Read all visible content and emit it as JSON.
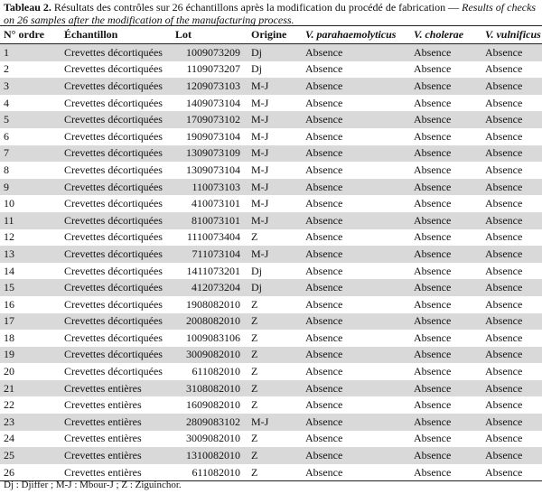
{
  "caption": {
    "label": "Tableau 2.",
    "text_fr": "Résultats des contrôles sur 26 échantillons après la modification du procédé de fabrication",
    "separator": " — ",
    "text_en": "Results of checks on 26 samples after the modification of the manufacturing process."
  },
  "table": {
    "headers": [
      "N° ordre",
      "Échantillon",
      "Lot",
      "Origine",
      "V. parahaemolyticus",
      "V. cholerae",
      "V. vulnificus"
    ],
    "rows": [
      [
        "1",
        "Crevettes décortiquées",
        "1009073209",
        "Dj",
        "Absence",
        "Absence",
        "Absence"
      ],
      [
        "2",
        "Crevettes décortiquées",
        "1109073207",
        "Dj",
        "Absence",
        "Absence",
        "Absence"
      ],
      [
        "3",
        "Crevettes décortiquées",
        "1209073103",
        "M-J",
        "Absence",
        "Absence",
        "Absence"
      ],
      [
        "4",
        "Crevettes décortiquées",
        "1409073104",
        "M-J",
        "Absence",
        "Absence",
        "Absence"
      ],
      [
        "5",
        "Crevettes décortiquées",
        "1709073102",
        "M-J",
        "Absence",
        "Absence",
        "Absence"
      ],
      [
        "6",
        "Crevettes décortiquées",
        "1909073104",
        "M-J",
        "Absence",
        "Absence",
        "Absence"
      ],
      [
        "7",
        "Crevettes décortiquées",
        "1309073109",
        "M-J",
        "Absence",
        "Absence",
        "Absence"
      ],
      [
        "8",
        "Crevettes décortiquées",
        "1309073104",
        "M-J",
        "Absence",
        "Absence",
        "Absence"
      ],
      [
        "9",
        "Crevettes décortiquées",
        "110073103",
        "M-J",
        "Absence",
        "Absence",
        "Absence"
      ],
      [
        "10",
        "Crevettes décortiquées",
        "410073101",
        "M-J",
        "Absence",
        "Absence",
        "Absence"
      ],
      [
        "11",
        "Crevettes décortiquées",
        "810073101",
        "M-J",
        "Absence",
        "Absence",
        "Absence"
      ],
      [
        "12",
        "Crevettes décortiquées",
        "1110073404",
        "Z",
        "Absence",
        "Absence",
        "Absence"
      ],
      [
        "13",
        "Crevettes décortiquées",
        "711073104",
        "M-J",
        "Absence",
        "Absence",
        "Absence"
      ],
      [
        "14",
        "Crevettes décortiquées",
        "1411073201",
        "Dj",
        "Absence",
        "Absence",
        "Absence"
      ],
      [
        "15",
        "Crevettes décortiquées",
        "412073204",
        "Dj",
        "Absence",
        "Absence",
        "Absence"
      ],
      [
        "16",
        "Crevettes décortiquées",
        "1908082010",
        "Z",
        "Absence",
        "Absence",
        "Absence"
      ],
      [
        "17",
        "Crevettes décortiquées",
        "2008082010",
        "Z",
        "Absence",
        "Absence",
        "Absence"
      ],
      [
        "18",
        "Crevettes décortiquées",
        "1009083106",
        "Z",
        "Absence",
        "Absence",
        "Absence"
      ],
      [
        "19",
        "Crevettes décortiquées",
        "3009082010",
        "Z",
        "Absence",
        "Absence",
        "Absence"
      ],
      [
        "20",
        "Crevettes décortiquées",
        "611082010",
        "Z",
        "Absence",
        "Absence",
        "Absence"
      ],
      [
        "21",
        "Crevettes entières",
        "3108082010",
        "Z",
        "Absence",
        "Absence",
        "Absence"
      ],
      [
        "22",
        "Crevettes entières",
        "1609082010",
        "Z",
        "Absence",
        "Absence",
        "Absence"
      ],
      [
        "23",
        "Crevettes entières",
        "2809083102",
        "M-J",
        "Absence",
        "Absence",
        "Absence"
      ],
      [
        "24",
        "Crevettes entières",
        "3009082010",
        "Z",
        "Absence",
        "Absence",
        "Absence"
      ],
      [
        "25",
        "Crevettes entières",
        "1310082010",
        "Z",
        "Absence",
        "Absence",
        "Absence"
      ],
      [
        "26",
        "Crevettes entières",
        "611082010",
        "Z",
        "Absence",
        "Absence",
        "Absence"
      ]
    ]
  },
  "footnote": "Dj : Djiffer ; M-J : Mbour-J ; Z : Ziguinchor.",
  "colors": {
    "row_shade": "#d9d9d9",
    "rule": "#222222"
  }
}
